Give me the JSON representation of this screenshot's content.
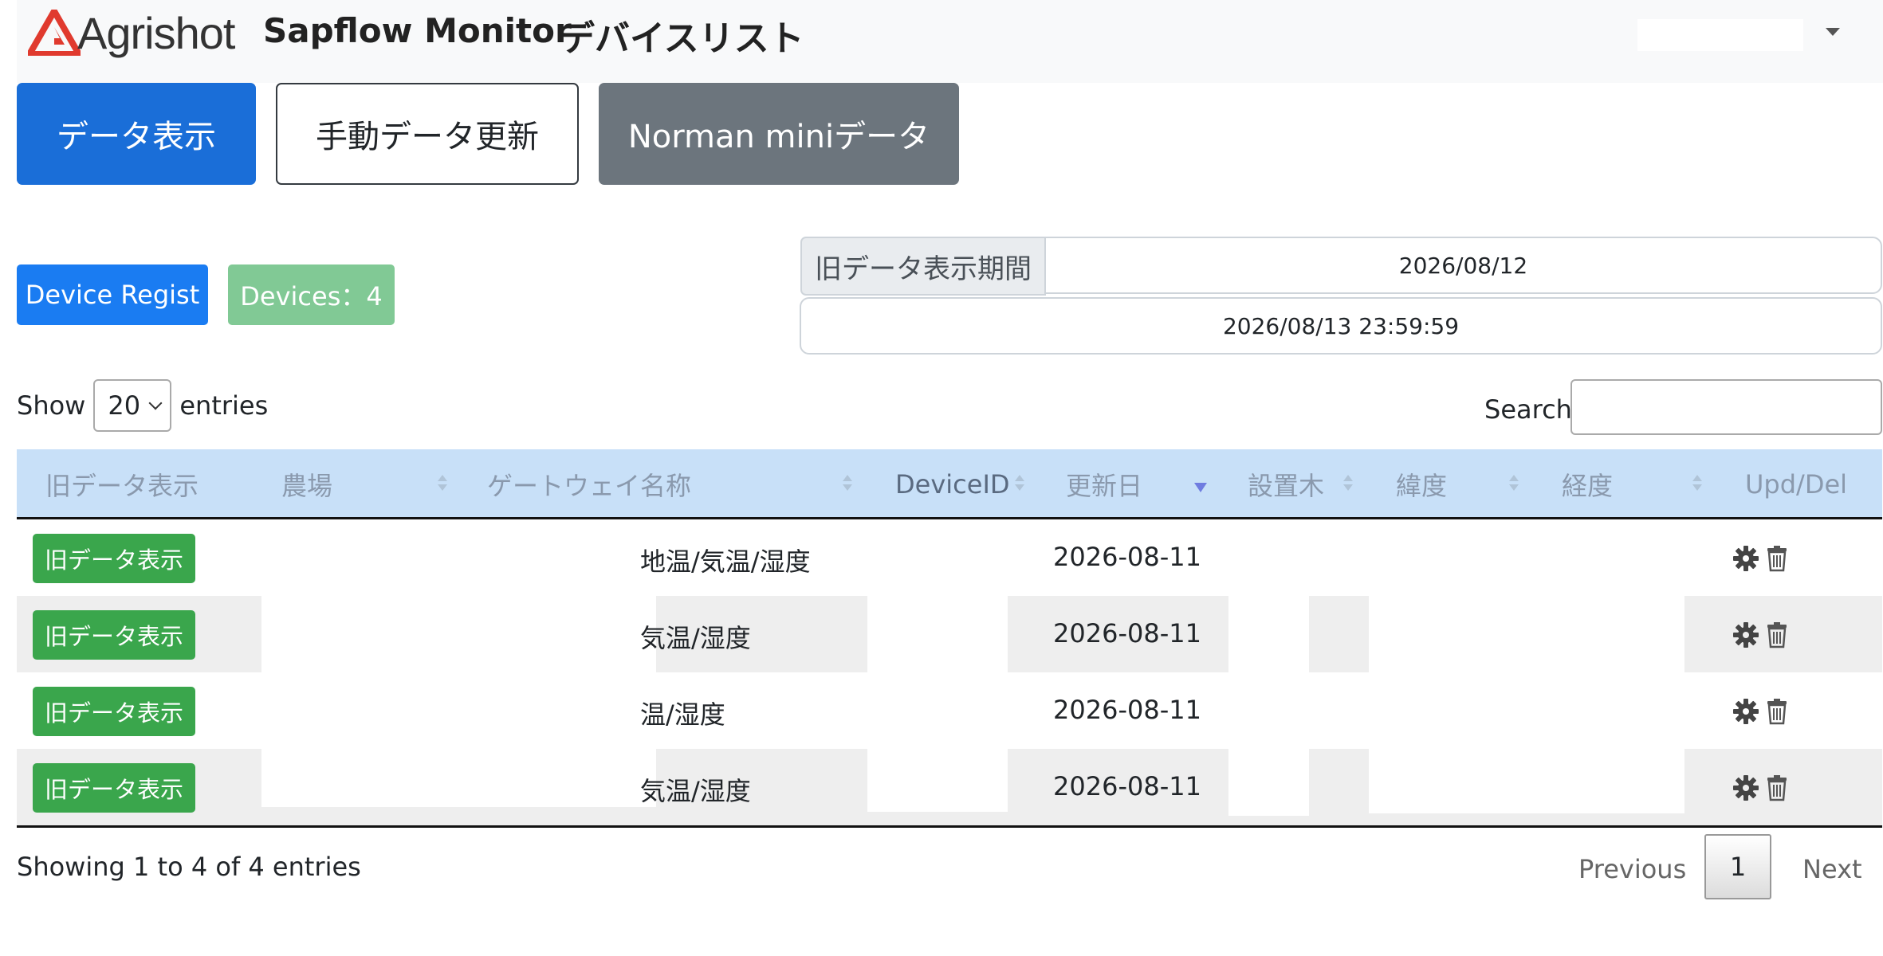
{
  "header": {
    "brand_word": "Agrishot",
    "app_title": "Sapflow Monitor",
    "page_title": "デバイスリスト",
    "brand_color": "#e03a2e"
  },
  "actions": {
    "data_display": "データ表示",
    "manual_update": "手動データ更新",
    "norman_mini": "Norman miniデータ"
  },
  "devices": {
    "regist_label": "Device Regist",
    "count_badge": "Devices：4"
  },
  "period": {
    "label": "旧データ表示期間",
    "start": "2026/08/12",
    "end": "2026/08/13 23:59:59"
  },
  "table_controls": {
    "show_label": "Show",
    "page_length": "20",
    "entries_label": "entries",
    "search_label": "Search:",
    "search_value": ""
  },
  "table": {
    "columns": [
      "旧データ表示",
      "農場",
      "ゲートウェイ名称",
      "DeviceID",
      "更新日",
      "設置木",
      "緯度",
      "経度",
      "Upd/Del"
    ],
    "sorted_column": "更新日",
    "sort_direction": "desc",
    "rows": [
      {
        "button": "旧データ表示",
        "sensor": "地温/気温/湿度",
        "updated": "2026-08-11"
      },
      {
        "button": "旧データ表示",
        "sensor": "気温/湿度",
        "updated": "2026-08-11"
      },
      {
        "button": "旧データ表示",
        "sensor": "温/湿度",
        "updated": "2026-08-11"
      },
      {
        "button": "旧データ表示",
        "sensor": "気温/湿度",
        "updated": "2026-08-11"
      }
    ],
    "row_icons": [
      "gear-icon",
      "trash-icon"
    ]
  },
  "footer": {
    "info": "Showing 1 to 4 of 4 entries",
    "previous": "Previous",
    "current_page": "1",
    "next": "Next"
  }
}
